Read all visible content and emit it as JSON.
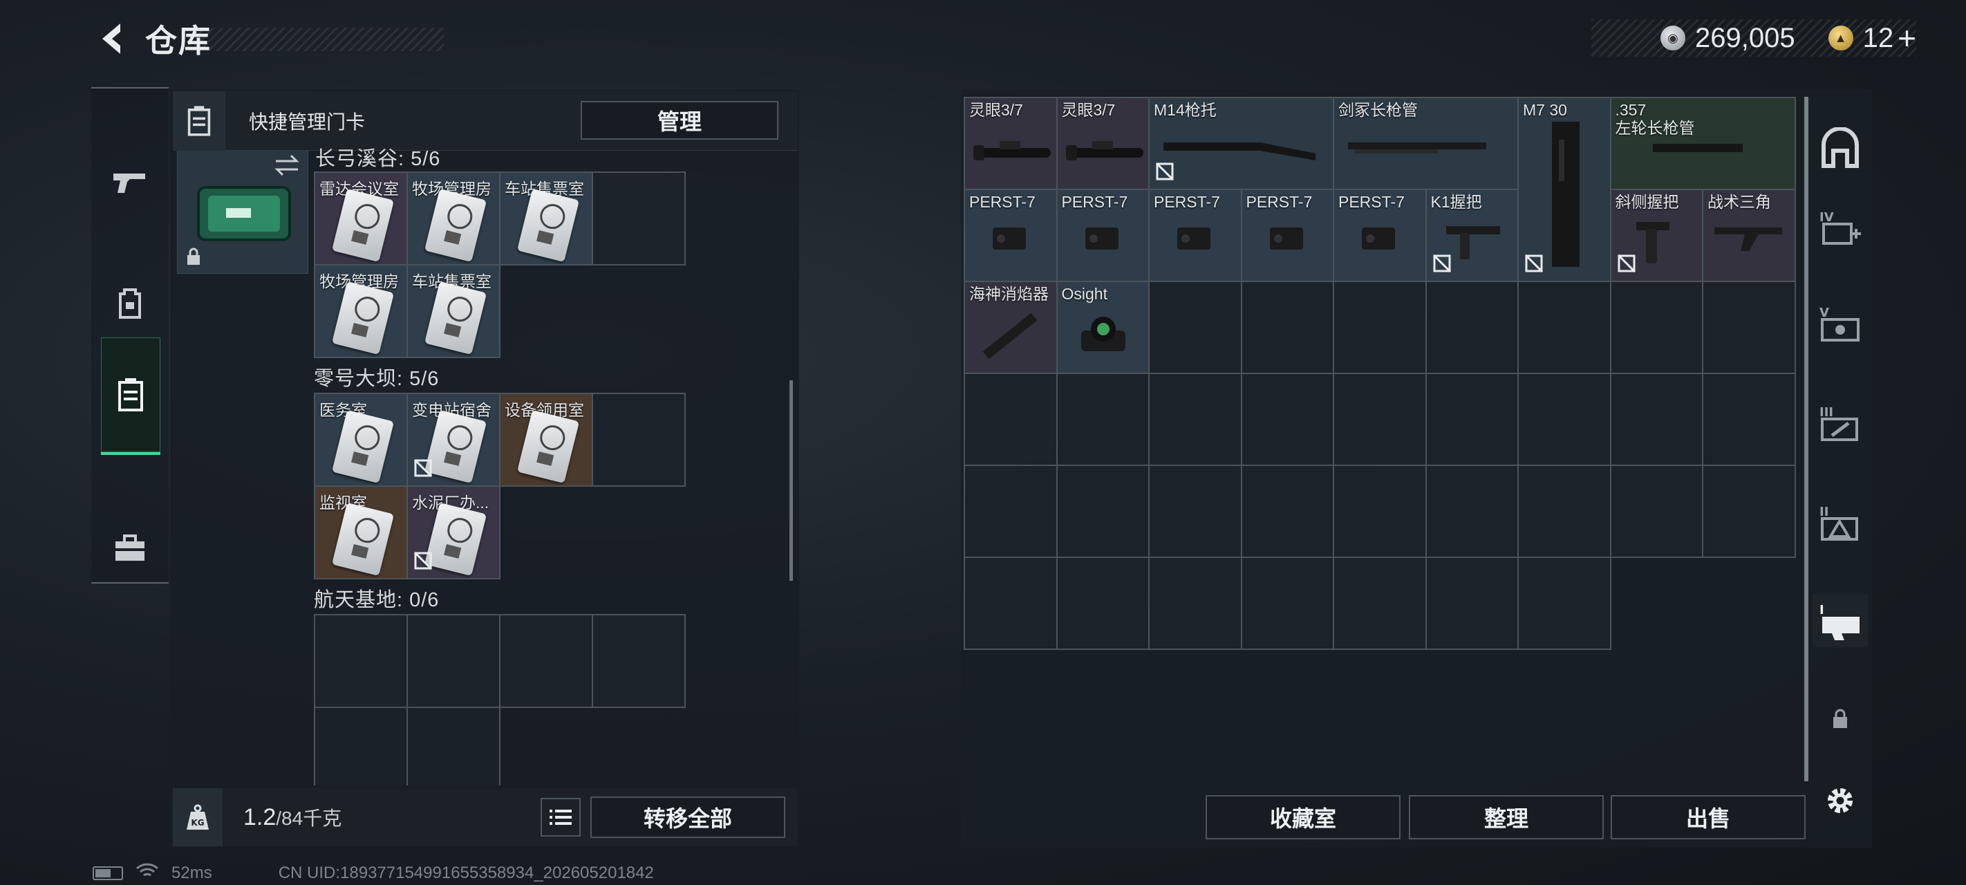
{
  "header": {
    "title": "仓库",
    "silver_balance": "269,005",
    "gold_balance": "12",
    "add_symbol": "+"
  },
  "keycard_panel": {
    "header_title": "快捷管理门卡",
    "manage_label": "管理",
    "sections": [
      {
        "title": "长弓溪谷: 5/6",
        "cards": [
          "雷达会议室",
          "牧场管理房",
          "车站售票室",
          "牧场管理房",
          "车站售票室"
        ]
      },
      {
        "title": "零号大坝: 5/6",
        "cards": [
          "医务室",
          "变电站宿舍",
          "设备领用室",
          "监视室",
          "水泥厂办..."
        ]
      },
      {
        "title": "航天基地: 0/6",
        "cards": []
      }
    ]
  },
  "footer": {
    "weight_current": "1.2",
    "weight_capacity": "/84千克",
    "transfer_all_label": "转移全部"
  },
  "storage": {
    "items": [
      "灵眼3/7",
      "灵眼3/7",
      "M14枪托",
      "剑冢长枪管",
      "M7 30",
      ".357\n左轮长枪管",
      "PERST-7",
      "PERST-7",
      "PERST-7",
      "PERST-7",
      "PERST-7",
      "K1握把",
      "斜侧握把",
      "战术三角",
      "海神消焰器",
      "Osight"
    ],
    "buttons": {
      "collection": "收藏室",
      "sort": "整理",
      "sell": "出售"
    }
  },
  "status": {
    "ping": "52ms",
    "uid": "CN UID:1893771549916553589​34_202605201842"
  },
  "colors": {
    "accent_green": "#46d49a",
    "background": "#141a20",
    "rarity_purple": "#3a3547",
    "rarity_blue": "#2f3e4a",
    "rarity_brown": "#4a3a2d"
  }
}
